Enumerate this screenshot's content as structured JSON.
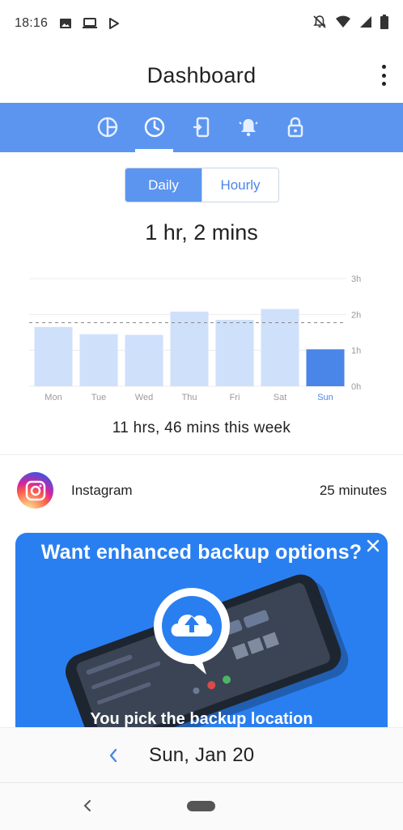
{
  "status_bar": {
    "time": "18:16",
    "left_icons": [
      "image-icon",
      "laptop-icon",
      "play-store-icon"
    ],
    "right_icons": [
      "notifications-off-icon",
      "wifi-icon",
      "signal-icon",
      "battery-icon"
    ]
  },
  "app_bar": {
    "title": "Dashboard",
    "menu_icon": "more-vert-icon"
  },
  "tabs": [
    {
      "icon": "pie-chart-icon",
      "selected": false
    },
    {
      "icon": "clock-icon",
      "selected": true
    },
    {
      "icon": "phone-unlock-icon",
      "selected": false
    },
    {
      "icon": "bell-icon",
      "selected": false
    },
    {
      "icon": "lock-icon",
      "selected": false
    }
  ],
  "view_toggle": {
    "daily": "Daily",
    "hourly": "Hourly",
    "selected": "Daily"
  },
  "today_total": "1 hr, 2 mins",
  "chart_data": {
    "type": "bar",
    "categories": [
      "Mon",
      "Tue",
      "Wed",
      "Thu",
      "Fri",
      "Sat",
      "Sun"
    ],
    "values": [
      1.65,
      1.45,
      1.43,
      2.08,
      1.85,
      2.15,
      1.03
    ],
    "y_tick_labels": [
      "3h",
      "2h",
      "1h",
      "0h"
    ],
    "ylim": [
      0,
      3
    ],
    "average_line": 1.77,
    "highlighted_category": "Sun",
    "colors": {
      "bar": "#cfe0fb",
      "highlight": "#4a86e8",
      "highlight_label": "#4a86e8",
      "label": "#9a9a9a"
    }
  },
  "week_total": "11 hrs, 46 mins this week",
  "app_usage": [
    {
      "name": "Instagram",
      "duration": "25 minutes",
      "icon": "instagram-icon"
    }
  ],
  "promo": {
    "title": "Want enhanced backup options?",
    "subtitle": "You pick the backup location",
    "close_icon": "close-icon",
    "image_icon": "cloud-upload-icon"
  },
  "date_nav": {
    "date": "Sun, Jan 20",
    "prev_icon": "chevron-left-icon"
  },
  "colors": {
    "accent": "#5b95f0",
    "promo_bg": "#2a7ff0"
  }
}
